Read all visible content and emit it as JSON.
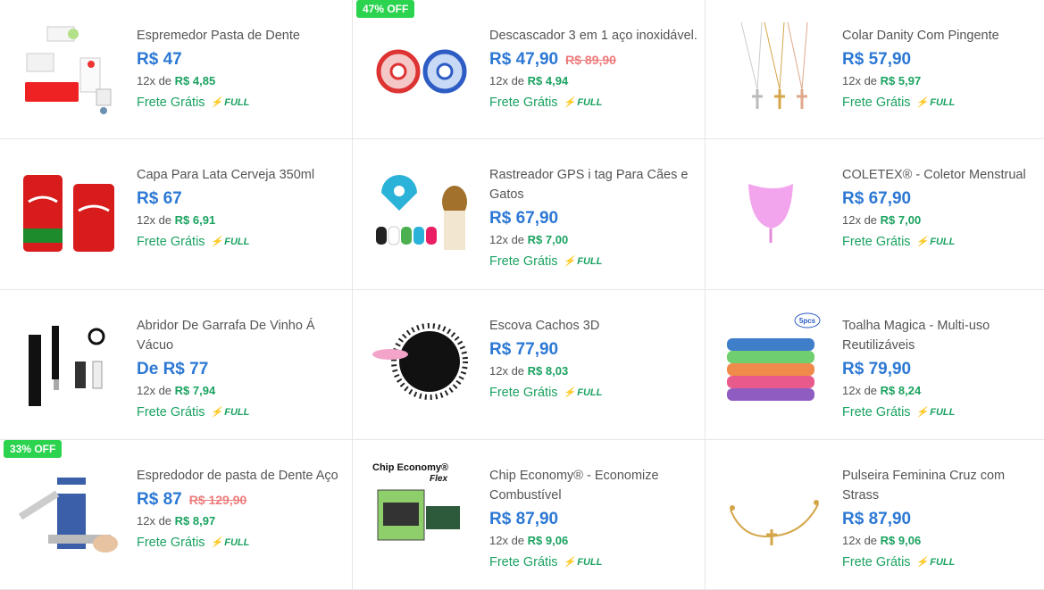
{
  "products": [
    {
      "title": "Espremedor Pasta de Dente",
      "price": "R$ 47",
      "old_price": "",
      "badge": "",
      "installments": "12x de",
      "installment_value": "R$ 4,85",
      "shipping": "Frete Grátis",
      "full": "FULL",
      "icon": "toothpaste-squeezer-image"
    },
    {
      "title": "Descascador 3 em 1 aço inoxidável.",
      "price": "R$ 47,90",
      "old_price": "R$ 89,90",
      "badge": "47% OFF",
      "installments": "12x de",
      "installment_value": "R$ 4,94",
      "shipping": "Frete Grátis",
      "full": "FULL",
      "icon": "peeler-image"
    },
    {
      "title": "Colar Danity Com Pingente",
      "price": "R$ 57,90",
      "old_price": "",
      "badge": "",
      "installments": "12x de",
      "installment_value": "R$ 5,97",
      "shipping": "Frete Grátis",
      "full": "FULL",
      "icon": "necklace-image"
    },
    {
      "title": "Capa Para Lata Cerveja 350ml",
      "price": "R$ 67",
      "old_price": "",
      "badge": "",
      "installments": "12x de",
      "installment_value": "R$ 6,91",
      "shipping": "Frete Grátis",
      "full": "FULL",
      "icon": "can-cover-image"
    },
    {
      "title": "Rastreador GPS i tag Para Cães e Gatos",
      "price": "R$ 67,90",
      "old_price": "",
      "badge": "",
      "installments": "12x de",
      "installment_value": "R$ 7,00",
      "shipping": "Frete Grátis",
      "full": "FULL",
      "icon": "gps-tag-image"
    },
    {
      "title": "COLETEX® - Coletor Menstrual",
      "price": "R$ 67,90",
      "old_price": "",
      "badge": "",
      "installments": "12x de",
      "installment_value": "R$ 7,00",
      "shipping": "Frete Grátis",
      "full": "FULL",
      "icon": "menstrual-cup-image"
    },
    {
      "title": "Abridor De Garrafa De Vinho Á Vácuo",
      "price": "De R$ 77",
      "old_price": "",
      "badge": "",
      "installments": "12x de",
      "installment_value": "R$ 7,94",
      "shipping": "Frete Grátis",
      "full": "FULL",
      "icon": "wine-opener-image"
    },
    {
      "title": "Escova Cachos 3D",
      "price": "R$ 77,90",
      "old_price": "",
      "badge": "",
      "installments": "12x de",
      "installment_value": "R$ 8,03",
      "shipping": "Frete Grátis",
      "full": "FULL",
      "icon": "hair-brush-image"
    },
    {
      "title": "Toalha Magica - Multi-uso Reutilizáveis",
      "price": "R$ 79,90",
      "old_price": "",
      "badge": "",
      "installments": "12x de",
      "installment_value": "R$ 8,24",
      "shipping": "Frete Grátis",
      "full": "FULL",
      "icon": "towels-image",
      "image_text": "5pcs"
    },
    {
      "title": "Espredodor de pasta de Dente Aço",
      "price": "R$ 87",
      "old_price": "R$ 129,90",
      "badge": "33% OFF",
      "installments": "12x de",
      "installment_value": "R$ 8,97",
      "shipping": "Frete Grátis",
      "full": "FULL",
      "icon": "steel-squeezer-image"
    },
    {
      "title": "Chip Economy® - Economize Combustível",
      "price": "R$ 87,90",
      "old_price": "",
      "badge": "",
      "installments": "12x de",
      "installment_value": "R$ 9,06",
      "shipping": "Frete Grátis",
      "full": "FULL",
      "icon": "chip-economy-image",
      "image_text": "Chip Economy®",
      "image_text2": "Flex"
    },
    {
      "title": "Pulseira Feminina Cruz com Strass",
      "price": "R$ 87,90",
      "old_price": "",
      "badge": "",
      "installments": "12x de",
      "installment_value": "R$ 9,06",
      "shipping": "Frete Grátis",
      "full": "FULL",
      "icon": "bracelet-image"
    }
  ],
  "colors": {
    "price": "#2c78d4",
    "green": "#1aa260",
    "badge": "#2bd34f",
    "old_price": "#ee7b7b"
  }
}
